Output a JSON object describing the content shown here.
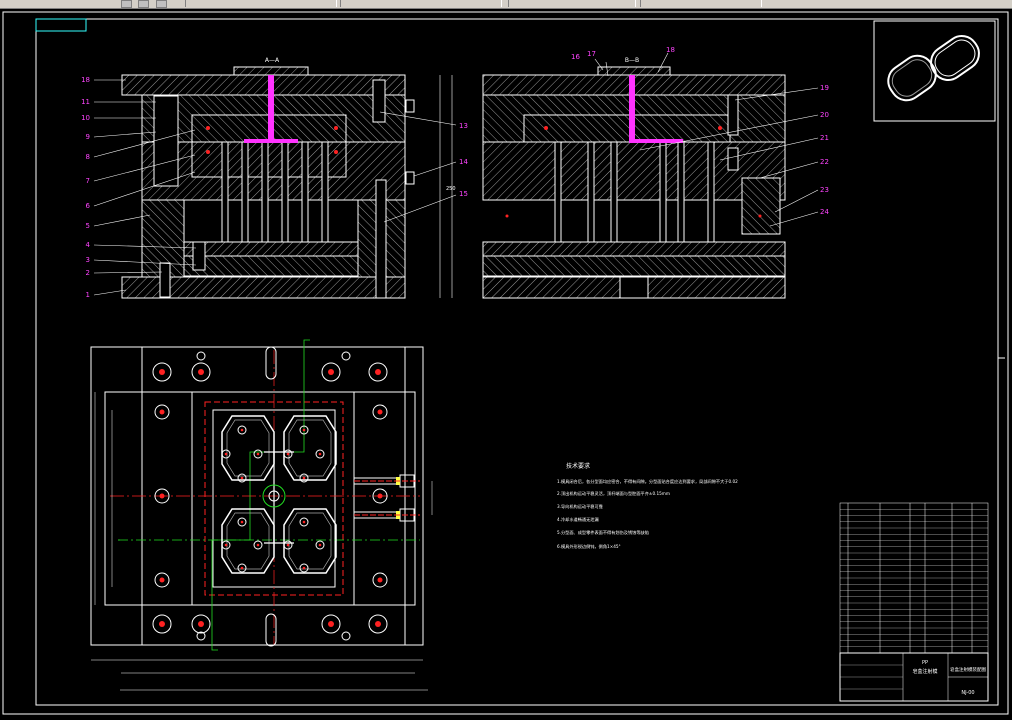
{
  "sections": {
    "a_a": "A—A",
    "b_b": "B—B"
  },
  "callouts_left": [
    "18",
    "11",
    "10",
    "9",
    "8",
    "7",
    "6",
    "5",
    "4",
    "3",
    "2",
    "1"
  ],
  "callouts_mid": [
    "13",
    "14",
    "15"
  ],
  "callouts_top": [
    "16",
    "17",
    "18"
  ],
  "callouts_right": [
    "19",
    "20",
    "21",
    "22",
    "23",
    "24"
  ],
  "tech_requirements": {
    "title": "技术要求",
    "items": [
      "1.模具闭合后，各分型面均应密合，不得有间隙。分型面贴合度应达到要求，局部间隙不大于0.02",
      "2.顶出机构运动平稳灵活，顶杆端面与型腔面平齐±0.15mm",
      "3.导向机构运动平稳可靠",
      "4.冷却水道畅通无泄漏",
      "5.分型面、成型零件表面不得有划伤及锈蚀等缺陷",
      "6.模具外形锐边倒钝，倒角1×45°"
    ]
  },
  "title_block": {
    "material": "PP",
    "part_name": "皂盒注射模",
    "drawing_title": "皂盒注射模装配图",
    "drawing_no": "NJ-00"
  },
  "colors": {
    "background": "#000000",
    "linework": "#ffffff",
    "section": "#c8c8c8",
    "centerline": "#ff2222",
    "callout": "#ff44ff",
    "sprue": "#ff33ff",
    "green": "#22dd22",
    "yellow": "#ffff44",
    "cyan": "#33ffff"
  }
}
